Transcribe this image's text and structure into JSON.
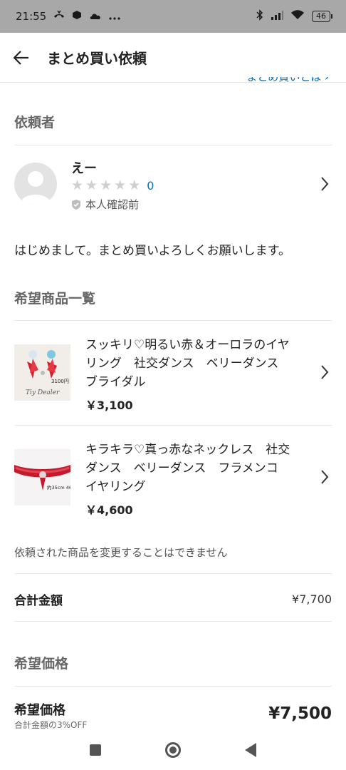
{
  "status_bar": {
    "time": "21:55",
    "battery": "46"
  },
  "header": {
    "title": "まとめ買い依頼"
  },
  "partial_link": "まとめ買いとは",
  "requester_section": {
    "title": "依頼者",
    "user": {
      "name": "えー",
      "rating_count": "0",
      "verification": "本人確認前"
    },
    "message": "はじめまして。まとめ買いよろしくお願いします。"
  },
  "products_section": {
    "title": "希望商品一覧",
    "items": [
      {
        "title": "スッキリ♡明るい赤＆オーロラのイヤリング　社交ダンス　ベリーダンス　ブライダル",
        "price": "￥3,100",
        "thumb_caption": "3100円",
        "thumb_brand": "Tiy Dealer"
      },
      {
        "title": "キラキラ♡真っ赤なネックレス　社交ダンス　ベリーダンス　フラメンコ　イヤリング",
        "price": "￥4,600",
        "thumb_caption": "約35cm 4600円"
      }
    ],
    "note": "依頼された商品を変更することはできません"
  },
  "total": {
    "label": "合計金額",
    "value": "¥7,700"
  },
  "desired_price_section": {
    "title": "希望価格",
    "label": "希望価格",
    "sub": "合計金額の3%OFF",
    "value": "¥7,500"
  },
  "colors": {
    "link": "#0a6fb6",
    "status_bar_bg": "#a8a8a8",
    "star_empty": "#cfcfcf"
  }
}
